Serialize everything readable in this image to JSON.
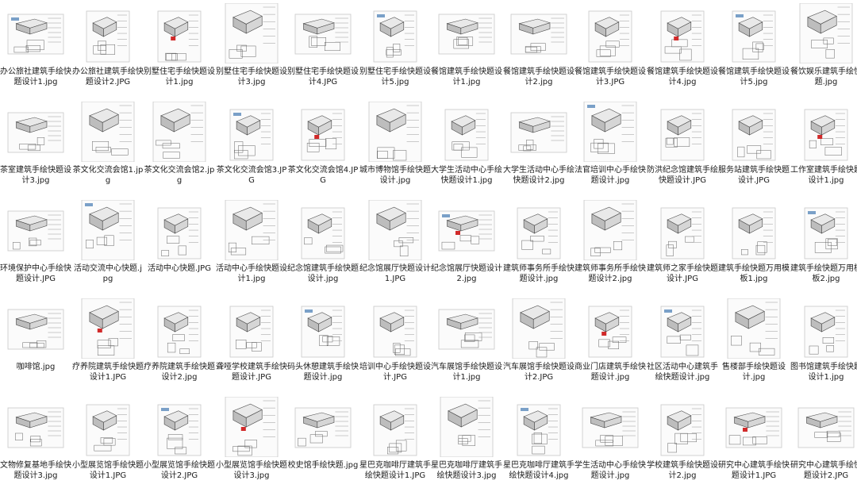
{
  "folder": {
    "files": [
      {
        "name": "办公旅社建筑手绘快题设计1.jpg",
        "kind": "landscape"
      },
      {
        "name": "办公旅社建筑手绘快题设计2.JPG",
        "kind": "portrait"
      },
      {
        "name": "别墅住宅手绘快题设计1.jpg",
        "kind": "portrait"
      },
      {
        "name": "别墅住宅手绘快题设计3.jpg",
        "kind": "tall"
      },
      {
        "name": "别墅住宅手绘快题设计4.JPG",
        "kind": "landscape"
      },
      {
        "name": "别墅住宅手绘快题设计5.jpg",
        "kind": "portrait"
      },
      {
        "name": "餐馆建筑手绘快题设计1.jpg",
        "kind": "landscape"
      },
      {
        "name": "餐馆建筑手绘快题设计2.jpg",
        "kind": "landscape"
      },
      {
        "name": "餐馆建筑手绘快题设计3.JPG",
        "kind": "portrait"
      },
      {
        "name": "餐馆建筑手绘快题设计4.jpg",
        "kind": "portrait"
      },
      {
        "name": "餐馆建筑手绘快题设计5.jpg",
        "kind": "portrait"
      },
      {
        "name": "餐饮娱乐建筑手绘快题.jpg",
        "kind": "tall"
      },
      {
        "name": "茶室建筑手绘快题设计3.jpg",
        "kind": "landscape"
      },
      {
        "name": "茶文化交流会馆1.jpg",
        "kind": "tall"
      },
      {
        "name": "茶文化交流会馆2.jpg",
        "kind": "tall"
      },
      {
        "name": "茶文化交流会馆3.JPG",
        "kind": "portrait"
      },
      {
        "name": "茶文化交流会馆4.JPG",
        "kind": "portrait"
      },
      {
        "name": "城市博物馆手绘快题设计.jpg",
        "kind": "tall"
      },
      {
        "name": "大学生活动中心手绘快题设计1.jpg",
        "kind": "portrait"
      },
      {
        "name": "大学生活动中心手绘快题设计2.jpg",
        "kind": "landscape"
      },
      {
        "name": "法官培训中心手绘快题设计.jpg",
        "kind": "tall"
      },
      {
        "name": "防洪纪念馆建筑手绘快题设计.JPG",
        "kind": "portrait"
      },
      {
        "name": "服务站建筑手绘快题设计.JPG",
        "kind": "portrait"
      },
      {
        "name": "工作室建筑手绘快题设计1.jpg",
        "kind": "portrait"
      },
      {
        "name": "环境保护中心手绘快题设计.JPG",
        "kind": "landscape"
      },
      {
        "name": "活动交流中心快题.jpg",
        "kind": "tall"
      },
      {
        "name": "活动中心快题.JPG",
        "kind": "portrait"
      },
      {
        "name": "活动中心手绘快题设计1.jpg",
        "kind": "tall"
      },
      {
        "name": "纪念馆建筑手绘快题设计.jpg",
        "kind": "portrait"
      },
      {
        "name": "纪念馆展厅快题设计1.JPG",
        "kind": "tall"
      },
      {
        "name": "纪念馆展厅快题设计2.jpg",
        "kind": "landscape"
      },
      {
        "name": "建筑师事务所手绘快题设计.jpg",
        "kind": "portrait"
      },
      {
        "name": "建筑师事务所手绘快题设计2.jpg",
        "kind": "tall"
      },
      {
        "name": "建筑师之家手绘快题设计.JPG",
        "kind": "portrait"
      },
      {
        "name": "建筑手绘快题万用模板1.jpg",
        "kind": "portrait"
      },
      {
        "name": "建筑手绘快题万用模板2.jpg",
        "kind": "portrait"
      },
      {
        "name": "咖啡馆.jpg",
        "kind": "landscape"
      },
      {
        "name": "疗养院建筑手绘快题设计1.JPG",
        "kind": "tall"
      },
      {
        "name": "疗养院建筑手绘快题设计2.jpg",
        "kind": "portrait"
      },
      {
        "name": "聋哑学校建筑手绘快题设计.JPG",
        "kind": "portrait"
      },
      {
        "name": "码头休憩建筑手绘快题设计.jpg",
        "kind": "portrait"
      },
      {
        "name": "培训中心手绘快题设计.JPG",
        "kind": "portrait"
      },
      {
        "name": "汽车展馆手绘快题设计1.jpg",
        "kind": "landscape"
      },
      {
        "name": "汽车展馆手绘快题设计2.JPG",
        "kind": "tall"
      },
      {
        "name": "商业门店建筑手绘快题设计.jpg",
        "kind": "portrait"
      },
      {
        "name": "社区活动中心建筑手绘快题设计.jpg",
        "kind": "portrait"
      },
      {
        "name": "售楼部手绘快题设计.jpg",
        "kind": "tall"
      },
      {
        "name": "图书馆建筑手绘快题设计1.jpg",
        "kind": "portrait"
      },
      {
        "name": "文物修复基地手绘快题设计3.jpg",
        "kind": "landscape"
      },
      {
        "name": "小型展览馆手绘快题设计1.JPG",
        "kind": "portrait"
      },
      {
        "name": "小型展览馆手绘快题设计2.JPG",
        "kind": "portrait"
      },
      {
        "name": "小型展览馆手绘快题设计3.jpg",
        "kind": "tall"
      },
      {
        "name": "校史馆手绘快题.jpg",
        "kind": "landscape"
      },
      {
        "name": "星巴克咖啡厅建筑手绘快题设计1.JPG",
        "kind": "portrait"
      },
      {
        "name": "星巴克咖啡厅建筑手绘快题设计3.jpg",
        "kind": "tall"
      },
      {
        "name": "星巴克咖啡厅建筑手绘快题设计4.jpg",
        "kind": "portrait"
      },
      {
        "name": "学生活动中心手绘快题设计.jpg",
        "kind": "landscape"
      },
      {
        "name": "学校建筑手绘快题设计2.jpg",
        "kind": "portrait"
      },
      {
        "name": "研究中心建筑手绘快题设计1.JPG",
        "kind": "landscape"
      },
      {
        "name": "研究中心建筑手绘快题设计2.JPG",
        "kind": "landscape"
      }
    ]
  }
}
